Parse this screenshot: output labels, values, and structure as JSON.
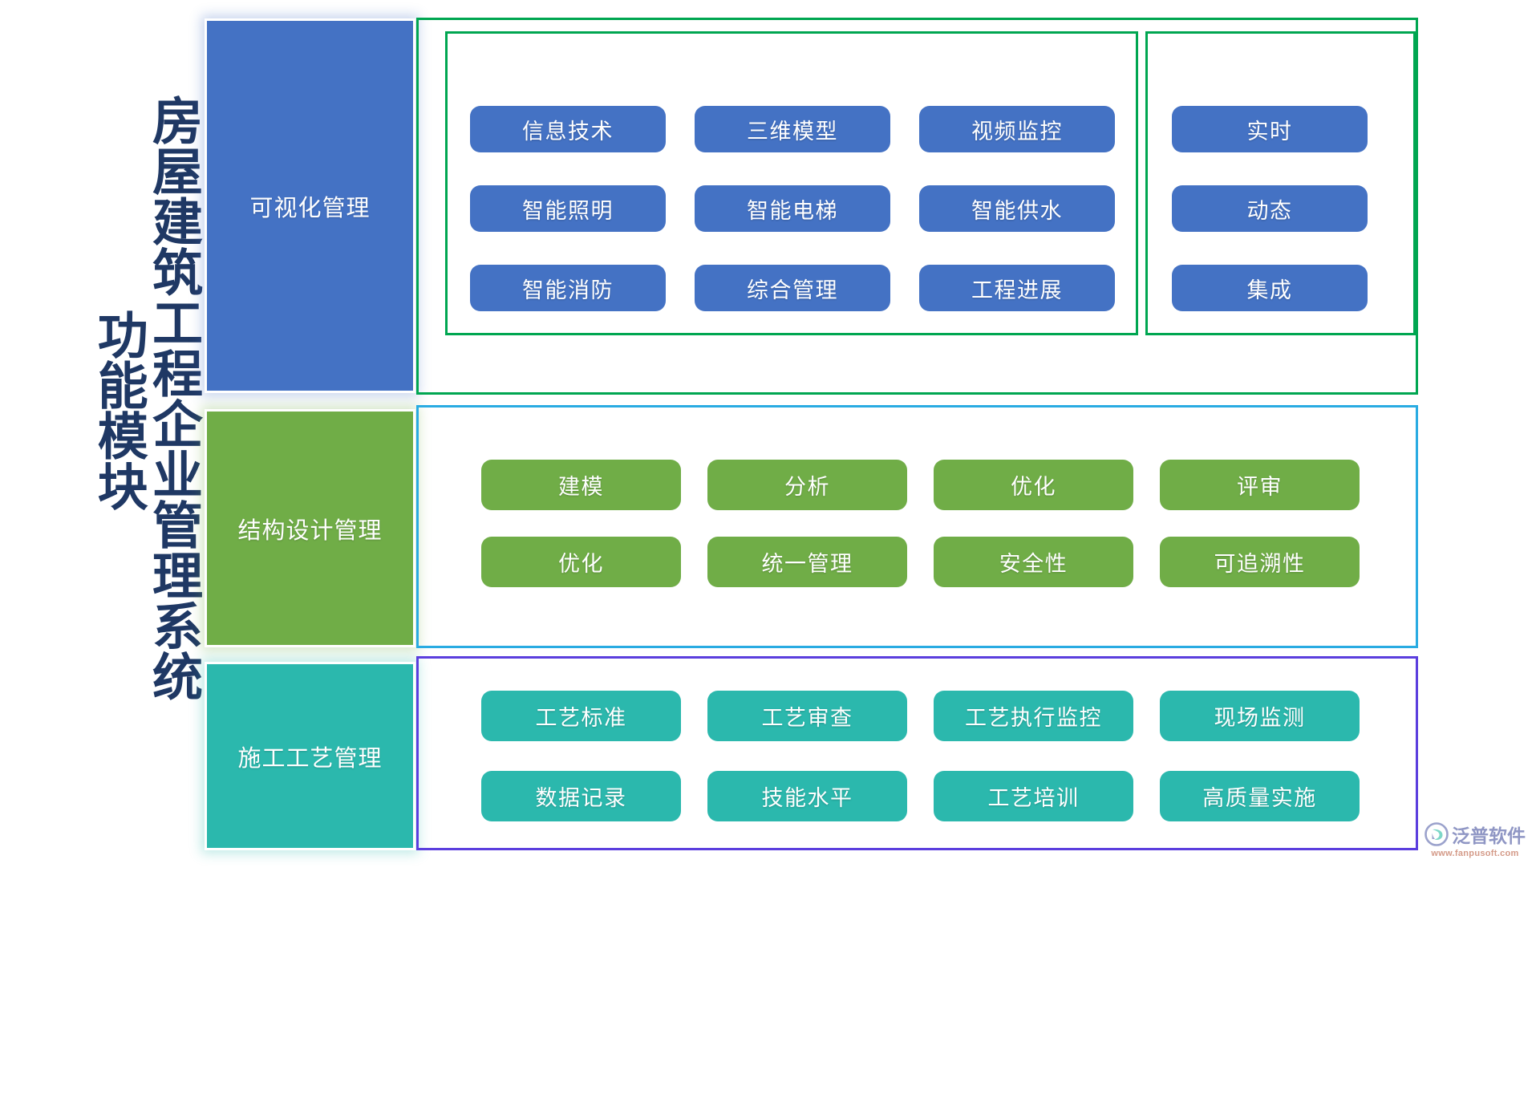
{
  "title": {
    "main": "房屋建筑工程企业管理系统",
    "sub": "功能模块",
    "color": "#1F3864"
  },
  "sections": [
    {
      "id": "visualization",
      "label": "可视化管理",
      "fill_color": "#4472C4",
      "border_color": "#00A651",
      "group_a": [
        [
          "信息技术",
          "三维模型",
          "视频监控"
        ],
        [
          "智能照明",
          "智能电梯",
          "智能供水"
        ],
        [
          "智能消防",
          "综合管理",
          "工程进展"
        ]
      ],
      "group_b": [
        "实时",
        "动态",
        "集成"
      ]
    },
    {
      "id": "structural-design",
      "label": "结构设计管理",
      "fill_color": "#70AD47",
      "border_color": "#29ABE2",
      "grid": [
        [
          "建模",
          "分析",
          "优化",
          "评审"
        ],
        [
          "优化",
          "统一管理",
          "安全性",
          "可追溯性"
        ]
      ]
    },
    {
      "id": "construction-process",
      "label": "施工工艺管理",
      "fill_color": "#2BB8AD",
      "border_color": "#5B3EDE",
      "grid": [
        [
          "工艺标准",
          "工艺审查",
          "工艺执行监控",
          "现场监测"
        ],
        [
          "数据记录",
          "技能水平",
          "工艺培训",
          "高质量实施"
        ]
      ]
    }
  ],
  "watermark": {
    "name": "泛普软件",
    "url": "www.fanpusoft.com",
    "name_color": "#8F96C4",
    "url_color": "#D49A88"
  }
}
